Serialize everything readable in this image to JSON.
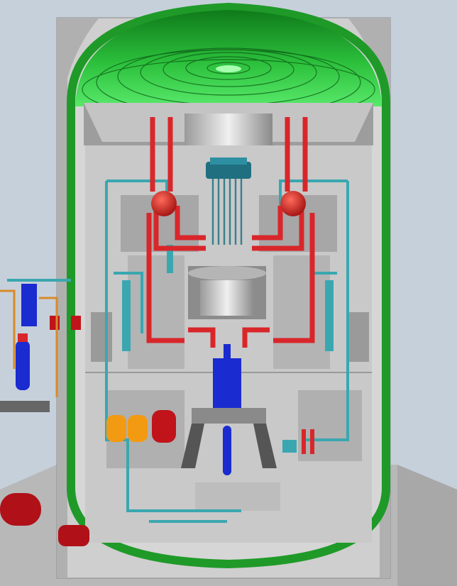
{
  "diagram": {
    "subject": "",
    "components": [
      {
        "id": "containment-dome"
      },
      {
        "id": "containment-vessel"
      },
      {
        "id": "reactor-pressure-vessel-head"
      },
      {
        "id": "control-rod-drives"
      },
      {
        "id": "steam-generator-left"
      },
      {
        "id": "steam-generator-right"
      },
      {
        "id": "primary-coolant-loop"
      },
      {
        "id": "cooling-water-piping"
      },
      {
        "id": "reactor-core-well"
      },
      {
        "id": "coolant-pump-blue"
      },
      {
        "id": "storage-tanks-orange"
      },
      {
        "id": "auxiliary-tank-red"
      },
      {
        "id": "external-equipment-left"
      },
      {
        "id": "external-pressure-tank"
      }
    ]
  },
  "colors": {
    "background": "#c6d0da",
    "concrete_light": "#d8d8d8",
    "concrete_mid": "#bcbcbc",
    "concrete_dark": "#8e8e8e",
    "containment_green": "#1f9a28",
    "dome_green_light": "#3ad24a",
    "primary_loop_red": "#d8262a",
    "cooling_pipe_teal": "#3aa7b0",
    "pump_blue": "#1a2bd0",
    "tank_orange": "#f29a12",
    "tank_red": "#c0141a",
    "rpv_head_teal": "#1f6f80"
  }
}
